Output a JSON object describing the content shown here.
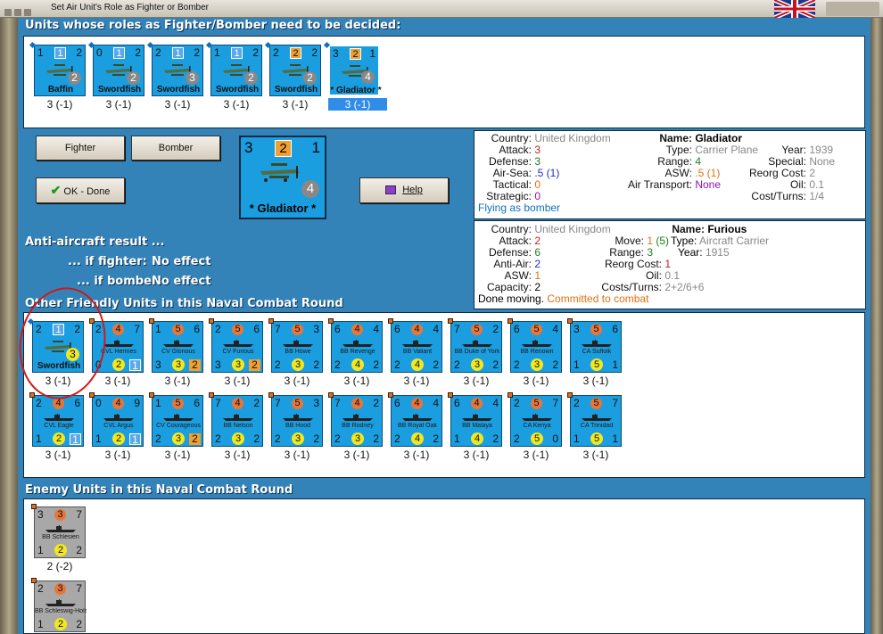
{
  "window": {
    "title": "Set Air Unit's Role as Fighter or Bomber"
  },
  "sections": {
    "undecided": "Units whose roles as Fighter/Bomber need to be decided:",
    "friendly": "Other Friendly Units in this Naval Combat Round",
    "enemy": "Enemy Units in this Naval Combat Round"
  },
  "air_units": [
    {
      "tl": "1",
      "tc": "1",
      "tr": "2",
      "br": "2",
      "name": "Baffin",
      "under": "3 (-1)"
    },
    {
      "tl": "0",
      "tc": "1",
      "tr": "2",
      "br": "2",
      "name": "Swordfish",
      "under": "3 (-1)"
    },
    {
      "tl": "2",
      "tc": "1",
      "tr": "2",
      "br": "3",
      "name": "Swordfish",
      "under": "3 (-1)"
    },
    {
      "tl": "1",
      "tc": "1",
      "tr": "2",
      "br": "2",
      "name": "Swordfish",
      "under": "3 (-1)"
    },
    {
      "tl": "2",
      "tc": "2",
      "tr": "2",
      "br": "2",
      "name": "Swordfish",
      "under": "3 (-1)"
    },
    {
      "tl": "3",
      "tc": "2",
      "tr": "1",
      "br": "4",
      "name": "* Gladiator *",
      "under": "3 (-1)"
    }
  ],
  "buttons": {
    "fighter": "Fighter",
    "bomber": "Bomber",
    "ok": "OK - Done",
    "help": "Help"
  },
  "selected": {
    "tl": "3",
    "tc": "2",
    "tr": "1",
    "br": "4",
    "name": "* Gladiator *"
  },
  "aircraft_info": {
    "country_lbl": "Country:",
    "country": "United Kingdom",
    "attack_lbl": "Attack:",
    "attack": "3",
    "defense_lbl": "Defense:",
    "defense": "3",
    "airsea_lbl": "Air-Sea:",
    "airsea": ".5 (1)",
    "tactical_lbl": "Tactical:",
    "tactical": "0",
    "strategic_lbl": "Strategic:",
    "strategic": "0",
    "name_lbl": "Name:",
    "name": "Gladiator",
    "type_lbl": "Type:",
    "type": "Carrier Plane",
    "year_lbl": "Year:",
    "year": "1939",
    "range_lbl": "Range:",
    "range": "4",
    "special_lbl": "Special:",
    "special": "None",
    "asw_lbl": "ASW:",
    "asw": ".5 (1)",
    "reorg_lbl": "Reorg Cost:",
    "reorg": "2",
    "airtrans_lbl": "Air Transport:",
    "airtrans": "None",
    "oil_lbl": "Oil:",
    "oil": "0.1",
    "cost_lbl": "Cost/Turns:",
    "cost": "1/4",
    "status": "Flying as bomber"
  },
  "carrier_info": {
    "country_lbl": "Country:",
    "country": "United Kingdom",
    "attack_lbl": "Attack:",
    "attack": "2",
    "defense_lbl": "Defense:",
    "defense": "6",
    "antiair_lbl": "Anti-Air:",
    "antiair": "2",
    "asw_lbl": "ASW:",
    "asw": "1",
    "capacity_lbl": "Capacity:",
    "capacity": "2",
    "name_lbl": "Name:",
    "name": "Furious",
    "move_lbl": "Move:",
    "move_a": "1",
    "move_b": "(5)",
    "type_lbl": "Type:",
    "type": "Aircraft Carrier",
    "range_lbl": "Range:",
    "range": "3",
    "year_lbl": "Year:",
    "year": "1915",
    "reorg_lbl": "Reorg Cost:",
    "reorg": "1",
    "oil_lbl": "Oil:",
    "oil": "0.1",
    "cost_lbl": "Costs/Turns:",
    "cost": "2+2/6+6",
    "status_a": "Done moving.",
    "status_b": "Committed to combat"
  },
  "aa": {
    "title": "Anti-aircraft result ...",
    "fighter_lbl": "... if fighter:",
    "fighter": "No effect",
    "bomber_lbl": "... if bomber:",
    "bomber": "No effect"
  },
  "friendly_row1": [
    {
      "kind": "air",
      "tl": "2",
      "tc": "1",
      "tr": "2",
      "br": "3",
      "name": "Swordfish",
      "under": "3 (-1)"
    },
    {
      "kind": "ship",
      "tl": "2",
      "tc": "4",
      "tr": "7",
      "bl": "0",
      "bc": "2",
      "brsq": "1",
      "brc": "blue",
      "name": "CVL Hermes",
      "under": "3 (-1)"
    },
    {
      "kind": "ship",
      "tl": "1",
      "tc": "5",
      "tr": "6",
      "bl": "3",
      "bc": "3",
      "brsq": "2",
      "brc": "orange",
      "name": "CV Glorious",
      "under": "3 (-1)"
    },
    {
      "kind": "ship",
      "tl": "2",
      "tc": "5",
      "tr": "6",
      "bl": "3",
      "bc": "3",
      "brsq": "2",
      "brc": "orange",
      "name": "CV Furious",
      "under": "3 (-1)"
    },
    {
      "kind": "ship",
      "tl": "7",
      "tc": "5",
      "tr": "3",
      "bl": "2",
      "bc": "3",
      "br": "2",
      "name": "BB Howe",
      "under": "3 (-1)"
    },
    {
      "kind": "ship",
      "tl": "6",
      "tc": "4",
      "tr": "4",
      "bl": "2",
      "bc": "4",
      "br": "2",
      "name": "BB Revenge",
      "under": "3 (-1)"
    },
    {
      "kind": "ship",
      "tl": "6",
      "tc": "4",
      "tr": "4",
      "bl": "2",
      "bc": "4",
      "br": "2",
      "name": "BB Valiant",
      "under": "3 (-1)"
    },
    {
      "kind": "ship",
      "tl": "7",
      "tc": "5",
      "tr": "2",
      "bl": "2",
      "bc": "3",
      "br": "2",
      "name": "BB Duke of York",
      "under": "3 (-1)"
    },
    {
      "kind": "ship",
      "tl": "6",
      "tc": "5",
      "tr": "4",
      "bl": "2",
      "bc": "3",
      "br": "2",
      "name": "BB Renown",
      "under": "3 (-1)"
    },
    {
      "kind": "ship",
      "tl": "3",
      "tc": "5",
      "tr": "6",
      "bl": "1",
      "bc": "5",
      "br": "1",
      "name": "CA Suffolk",
      "under": "3 (-1)"
    }
  ],
  "friendly_row2": [
    {
      "tl": "2",
      "tc": "4",
      "tr": "6",
      "bl": "1",
      "bc": "2",
      "brsq": "1",
      "brc": "blue",
      "name": "CVL Eagle",
      "under": "3 (-1)"
    },
    {
      "tl": "0",
      "tc": "4",
      "tr": "9",
      "bl": "1",
      "bc": "2",
      "brsq": "1",
      "brc": "blue",
      "name": "CVL Argus",
      "under": "3 (-1)"
    },
    {
      "tl": "1",
      "tc": "5",
      "tr": "6",
      "bl": "2",
      "bc": "3",
      "brsq": "2",
      "brc": "orange",
      "name": "CV Courageous",
      "under": "3 (-1)"
    },
    {
      "tl": "7",
      "tc": "4",
      "tr": "2",
      "bl": "2",
      "bc": "3",
      "br": "2",
      "name": "BB Nelson",
      "under": "3 (-1)"
    },
    {
      "tl": "7",
      "tc": "5",
      "tr": "3",
      "bl": "2",
      "bc": "3",
      "br": "2",
      "name": "BB Hood",
      "under": "3 (-1)"
    },
    {
      "tl": "7",
      "tc": "4",
      "tr": "2",
      "bl": "2",
      "bc": "3",
      "br": "2",
      "name": "BB Rodney",
      "under": "3 (-1)"
    },
    {
      "tl": "6",
      "tc": "4",
      "tr": "4",
      "bl": "2",
      "bc": "4",
      "br": "2",
      "name": "BB Royal Oak",
      "under": "3 (-1)"
    },
    {
      "tl": "6",
      "tc": "4",
      "tr": "4",
      "bl": "1",
      "bc": "4",
      "br": "2",
      "name": "BB Malaya",
      "under": "3 (-1)"
    },
    {
      "tl": "2",
      "tc": "5",
      "tr": "7",
      "bl": "2",
      "bc": "5",
      "br": "0",
      "name": "CA Kenya",
      "under": "3 (-1)"
    },
    {
      "tl": "2",
      "tc": "5",
      "tr": "7",
      "bl": "1",
      "bc": "5",
      "br": "1",
      "name": "CA Trinidad",
      "under": "3 (-1)"
    }
  ],
  "enemy_units": [
    {
      "tl": "3",
      "tc": "3",
      "tr": "7",
      "bl": "1",
      "bc": "2",
      "br": "2",
      "name": "BB Schlesien",
      "under": "2 (-2)"
    },
    {
      "tl": "2",
      "tc": "3",
      "tr": "7",
      "bl": "1",
      "bc": "2",
      "br": "2",
      "name": "BB Schleswig-Holstein",
      "under": ""
    }
  ],
  "colors": {
    "bg": "#3383b8",
    "counter": "#1a9ee0",
    "enemy": "#a8a8a8",
    "attack": "#e8763a",
    "defense": "#f2e820"
  }
}
